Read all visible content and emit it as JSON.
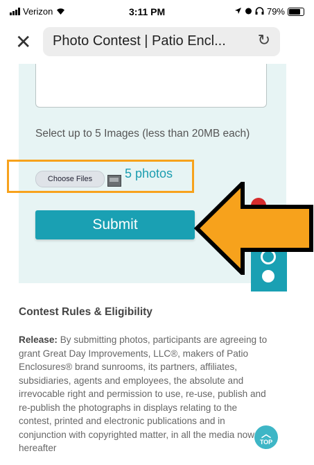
{
  "status_bar": {
    "carrier": "Verizon",
    "time": "3:11 PM",
    "battery": "79%"
  },
  "address_bar": {
    "page_title": "Photo Contest | Patio Encl..."
  },
  "form": {
    "help_text": "Select up to 5 Images (less than 20MB each)",
    "choose_files_label": "Choose Files",
    "file_count": "5 photos",
    "submit_label": "Submit"
  },
  "rules": {
    "heading": "Contest Rules & Eligibility",
    "release_label": "Release:",
    "release_text": " By submitting photos, participants are agreeing to grant Great Day Improvements, LLC®, makers of Patio Enclosures® brand sunrooms, its partners, affiliates, subsidiaries, agents and employees, the absolute and irrevocable right and permission to use, re-use, publish and re-publish the photographs in displays relating to the contest, printed and electronic publications and in conjunction with copyrighted matter, in all the media now or hereafter"
  },
  "back_to_top": {
    "label": "TOP"
  },
  "colors": {
    "accent": "#1aa0b3",
    "highlight": "#f7a21c",
    "panel_bg": "#e7f4f4"
  }
}
